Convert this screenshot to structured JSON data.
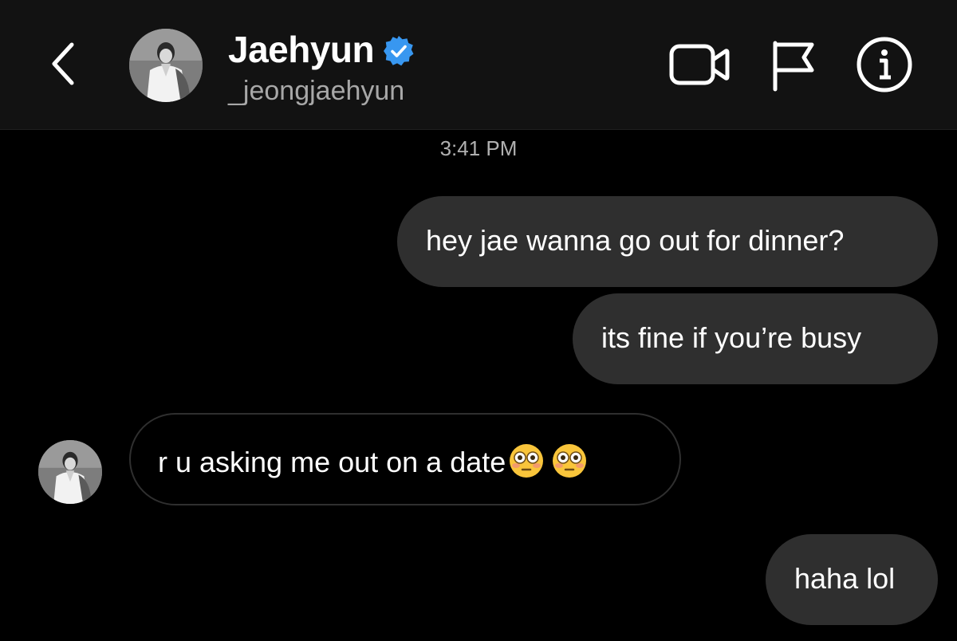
{
  "header": {
    "name": "Jaehyun",
    "username": "_jeongjaehyun",
    "icons": {
      "back": "chevron-left-icon",
      "verified": "verified-badge-icon",
      "video": "video-camera-icon",
      "flag": "flag-icon",
      "info": "info-icon"
    },
    "verified_color": "#3897f0"
  },
  "chat": {
    "timestamp": "3:41 PM",
    "messages": [
      {
        "sender": "me",
        "text": "hey jae wanna go out for dinner?"
      },
      {
        "sender": "me",
        "text": "its fine if you’re busy"
      },
      {
        "sender": "them",
        "text": "r u asking me out on a date",
        "emoji": [
          "flushed-face-emoji",
          "flushed-face-emoji"
        ]
      },
      {
        "sender": "me",
        "text": "haha lol"
      }
    ]
  },
  "colors": {
    "background": "#000000",
    "header_background": "#121212",
    "sent_bubble": "#2f2f2f",
    "received_border": "#2f2f2f",
    "secondary_text": "#a8a8a8"
  }
}
